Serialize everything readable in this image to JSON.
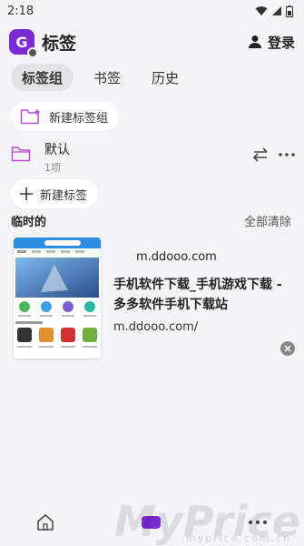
{
  "status": {
    "time": "2:18"
  },
  "header": {
    "logo_letter": "G",
    "title": "标签",
    "login_label": "登录"
  },
  "tabs": [
    {
      "label": "标签组",
      "active": true
    },
    {
      "label": "书签"
    },
    {
      "label": "历史"
    }
  ],
  "new_group_label": "新建标签组",
  "group": {
    "name": "默认",
    "count": "1项"
  },
  "new_tab_label": "新建标签",
  "section": {
    "title": "临时的",
    "clear_label": "全部清除"
  },
  "tab_card": {
    "domain": "m.ddooo.com",
    "title": "手机软件下载_手机游戏下载 - 多多软件手机下载站",
    "url": "m.ddooo.com/"
  },
  "watermark": {
    "text": "MyPrice",
    "sub": "myprice.com.cn"
  },
  "colors": {
    "accent": "#7c2ad6",
    "folder": "#b64bd6"
  }
}
